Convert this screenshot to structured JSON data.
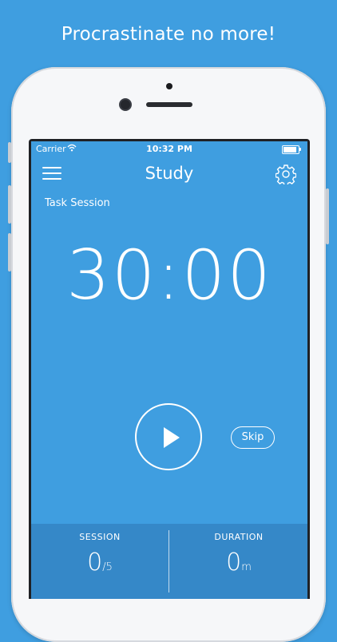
{
  "tagline": "Procrastinate no more!",
  "status_bar": {
    "carrier": "Carrier",
    "time": "10:32 PM"
  },
  "nav": {
    "title": "Study"
  },
  "session": {
    "label": "Task Session"
  },
  "timer": {
    "minutes": "30",
    "separator": ":",
    "seconds": "00"
  },
  "controls": {
    "skip_label": "Skip"
  },
  "stats": {
    "session": {
      "label": "SESSION",
      "value": "0",
      "unit": "/5"
    },
    "duration": {
      "label": "DURATION",
      "value": "0",
      "unit": "m"
    }
  },
  "colors": {
    "background": "#3f9ee0",
    "stats_panel": "#3588c8"
  },
  "icons": {
    "menu": "hamburger-icon",
    "settings": "gear-icon",
    "play": "play-icon",
    "wifi": "wifi-icon",
    "battery": "battery-icon"
  }
}
